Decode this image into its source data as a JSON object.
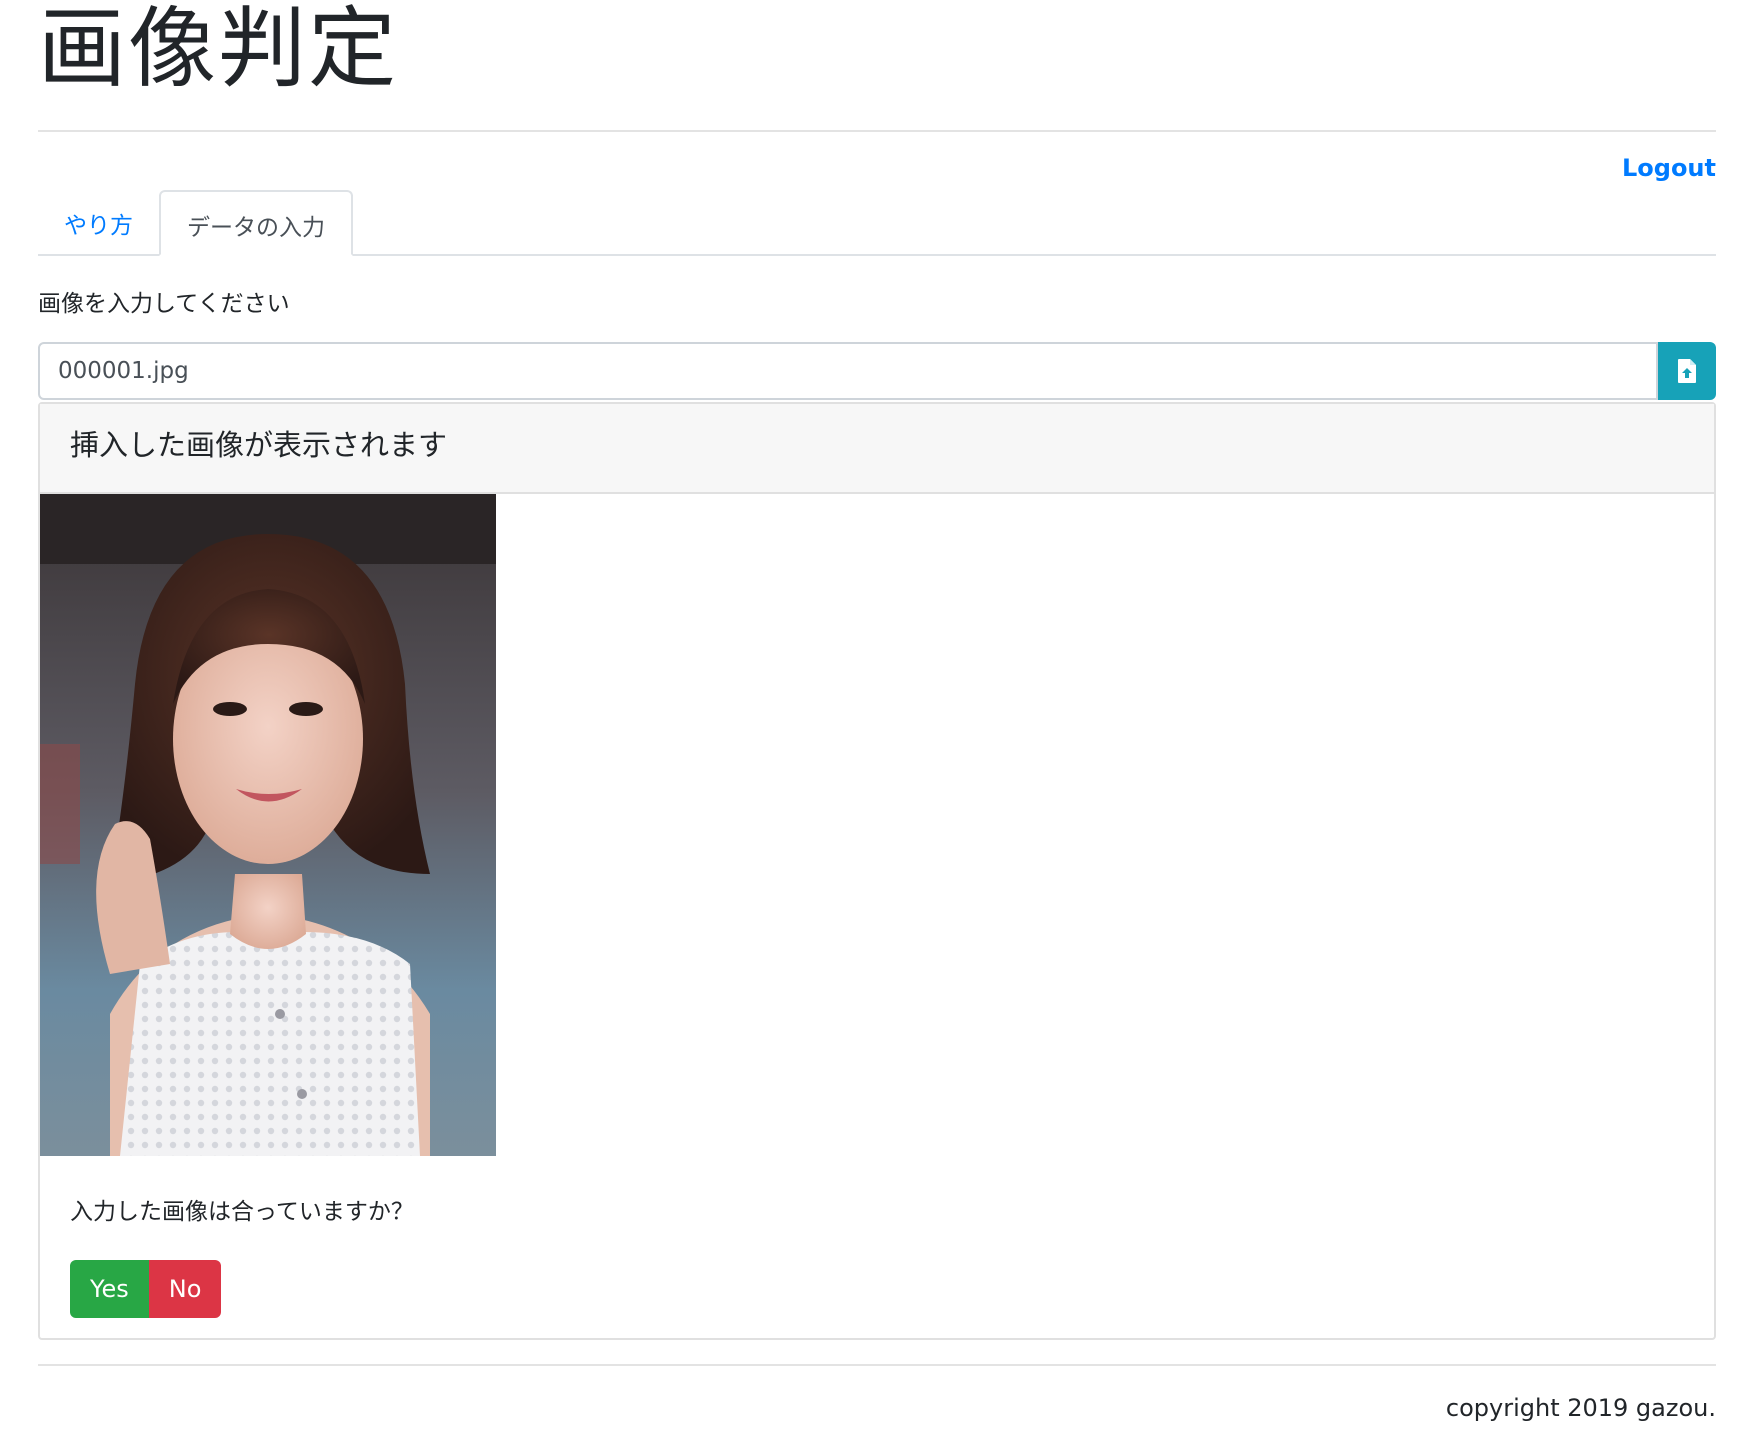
{
  "header": {
    "title": "画像判定"
  },
  "nav": {
    "logout_label": "Logout"
  },
  "tabs": [
    {
      "label": "やり方",
      "active": false
    },
    {
      "label": "データの入力",
      "active": true
    }
  ],
  "form": {
    "instruction": "画像を入力してください",
    "file_value": "000001.jpg",
    "upload_icon": "file-upload-icon"
  },
  "preview": {
    "header": "挿入した画像が表示されます",
    "question": "入力した画像は合っていますか？",
    "yes_label": "Yes",
    "no_label": "No"
  },
  "footer": {
    "copyright": "copyright 2019 gazou."
  },
  "colors": {
    "link": "#007bff",
    "upload_button": "#17a2b8",
    "yes_button": "#28a745",
    "no_button": "#dc3545"
  }
}
